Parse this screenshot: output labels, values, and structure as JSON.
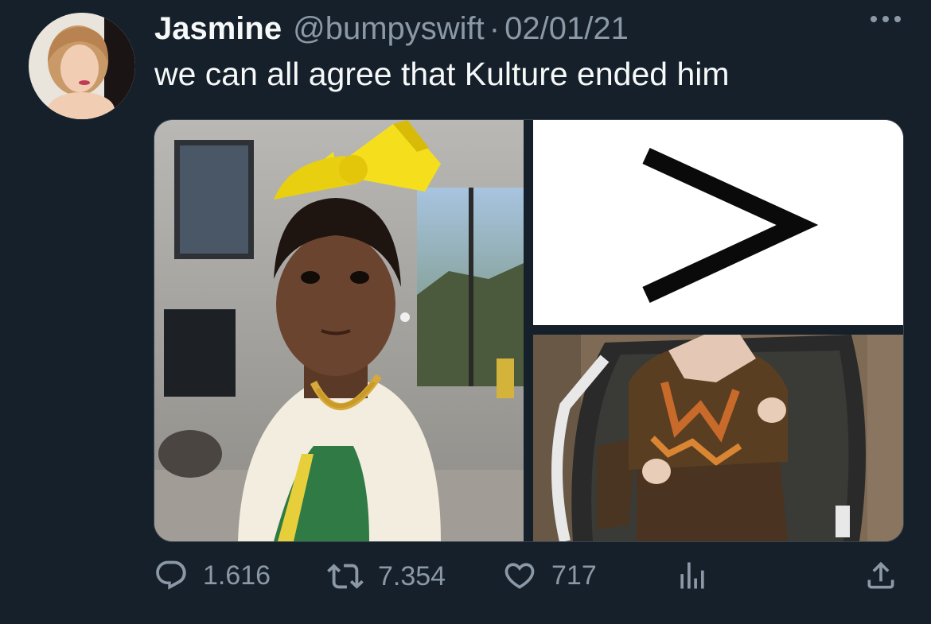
{
  "tweet": {
    "author_name": "Jasmine",
    "handle": "@bumpyswift",
    "separator": "·",
    "date": "02/01/21",
    "text": "we can all agree that Kulture ended him"
  },
  "media": {
    "images": [
      {
        "icon": "photo-child-yellow-bow"
      },
      {
        "icon": "greater-than-symbol"
      },
      {
        "icon": "photo-baby-in-bouncer"
      }
    ]
  },
  "actions": {
    "reply_count": "1.616",
    "retweet_count": "7.354",
    "like_count": "717"
  },
  "colors": {
    "background": "#15202b",
    "text_primary": "#f7f9f9",
    "text_secondary": "#8b98a5",
    "border": "#38444d"
  }
}
